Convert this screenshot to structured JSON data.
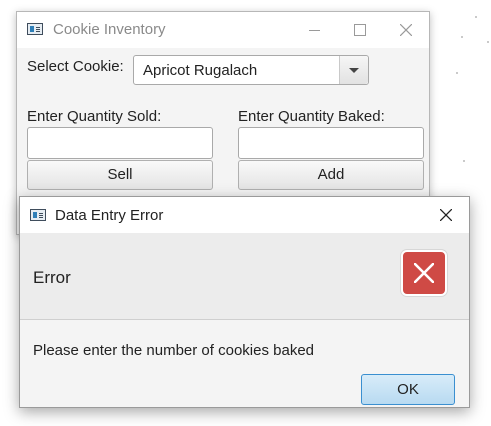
{
  "main_window": {
    "title": "Cookie Inventory",
    "select_cookie_label": "Select Cookie:",
    "selected_cookie": "Apricot Rugalach",
    "qty_sold_label": "Enter Quantity Sold:",
    "qty_baked_label": "Enter Quantity Baked:",
    "qty_sold_value": "",
    "qty_baked_value": "",
    "sell_label": "Sell",
    "add_label": "Add"
  },
  "dialog": {
    "title": "Data Entry Error",
    "header": "Error",
    "message": "Please enter the number of cookies baked",
    "ok_label": "OK",
    "error_icon": "error-x-icon",
    "accent_color": "#cf4a45",
    "ok_color": "#3a8fd0"
  }
}
